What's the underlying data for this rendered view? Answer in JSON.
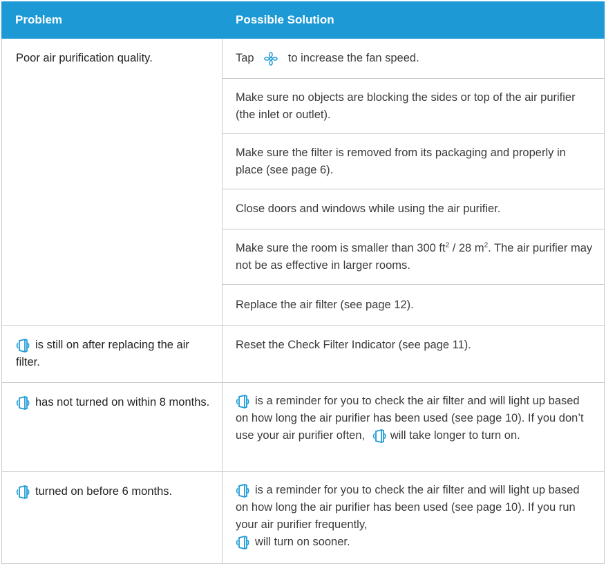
{
  "header": {
    "problem": "Problem",
    "solution": "Possible Solution"
  },
  "rows": [
    {
      "problem": "Poor air purification quality.",
      "solutions": [
        {
          "before": "Tap",
          "icon": "fan-icon",
          "after": "to increase the fan speed."
        },
        {
          "text": "Make sure no objects are blocking the sides or top of the air purifier (the inlet or outlet)."
        },
        {
          "text": "Make sure the filter is removed from its packaging and properly in place (see page 6)."
        },
        {
          "text": "Close doors and windows while using the air purifier."
        },
        {
          "a": "Make sure the room is smaller than 300 ft",
          "sup1": "2",
          "b": " / 28 m",
          "sup2": "2",
          "c": ". The air purifier may not be as effective in larger rooms."
        },
        {
          "text": "Replace the air filter (see page 12)."
        }
      ]
    },
    {
      "icon": "check-filter-indicator-icon",
      "problem": "is still on after replacing the air filter.",
      "solutions": [
        {
          "text": "Reset the Check Filter Indicator (see page 11)."
        }
      ]
    },
    {
      "icon": "check-filter-indicator-icon",
      "problem": "has not turned on within 8 months.",
      "solutions": [
        {
          "a": "is a reminder for you to check the air filter and will light up based on how long the air purifier has been used (see page 10). If you don’t use your air purifier often,",
          "b": "will take longer to turn on."
        }
      ]
    },
    {
      "icon": "check-filter-indicator-icon",
      "problem": "turned on before 6 months.",
      "solutions": [
        {
          "a": "is a reminder for you to check the air filter and will light up based on how long the air purifier has been used (see page 10). If you run your air purifier frequently,",
          "b": "will turn on sooner."
        }
      ]
    }
  ],
  "colors": {
    "header_bg": "#1d9ad6",
    "icon": "#1d9ad6",
    "border": "#c9c9c9"
  }
}
